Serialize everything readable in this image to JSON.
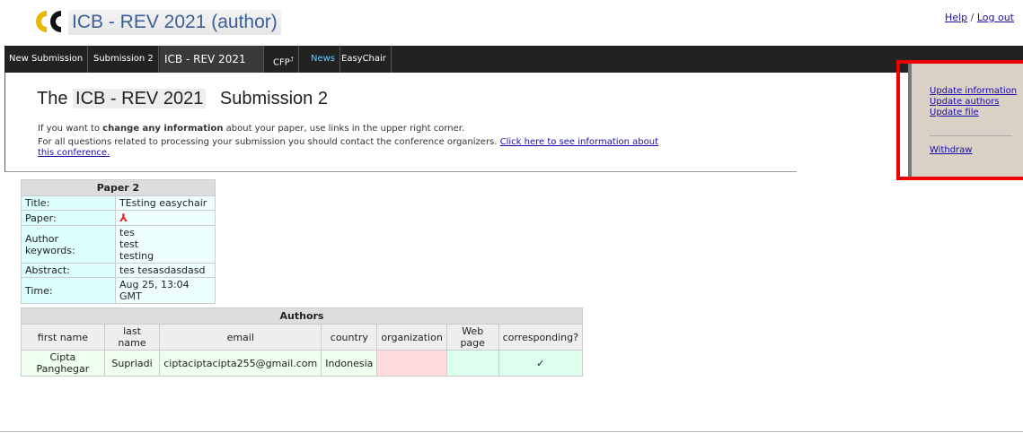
{
  "header": {
    "title": "ICB - REV 2021 (author)",
    "help_label": "Help",
    "separator": "/",
    "logout_label": "Log out"
  },
  "menu": {
    "new_submission": "New Submission",
    "submission2": "Submission 2",
    "conf": "ICB - REV 2021",
    "cfp": "CFP",
    "news": "News",
    "easychair": "EasyChair"
  },
  "main": {
    "title_prefix": "The",
    "title_conf": "ICB - REV 2021",
    "title_suffix": "Submission 2",
    "intro1_pre": "If you want to ",
    "intro1_bold": "change any information",
    "intro1_post": " about your paper, use links in the upper right corner.",
    "intro2_pre": "For all questions related to processing your submission you should contact the conference organizers. ",
    "intro2_link": "Click here to see information about this conference."
  },
  "sidebar": {
    "update_information": "Update information",
    "update_authors": "Update authors",
    "update_file": "Update file",
    "withdraw": "Withdraw"
  },
  "paper": {
    "caption": "Paper 2",
    "title_label": "Title:",
    "title_value": "TEsting easychair",
    "paper_label": "Paper:",
    "keywords_label": "Author keywords:",
    "keywords": [
      "tes",
      "test",
      "testing"
    ],
    "abstract_label": "Abstract:",
    "abstract_value": "tes tesasdasdasd",
    "time_label": "Time:",
    "time_value": "Aug 25, 13:04 GMT"
  },
  "authors": {
    "caption": "Authors",
    "columns": [
      "first name",
      "last name",
      "email",
      "country",
      "organization",
      "Web page",
      "corresponding?"
    ],
    "rows": [
      {
        "first_name": "Cipta Panghegar",
        "last_name": "Supriadi",
        "email": "ciptaciptacipta255@gmail.com",
        "country": "Indonesia",
        "organization": "",
        "web_page": "",
        "corresponding": "✓"
      }
    ]
  }
}
